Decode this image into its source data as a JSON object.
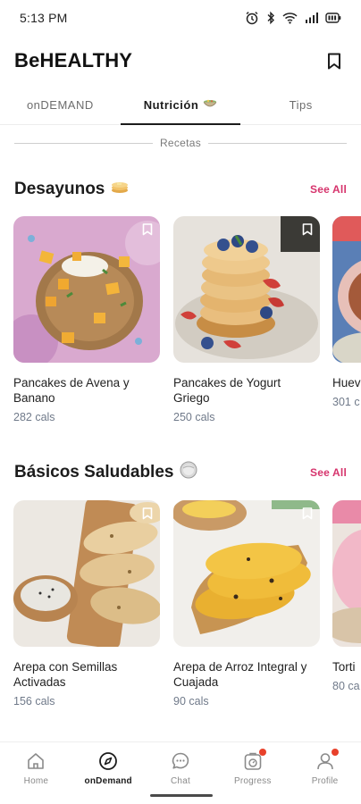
{
  "status_bar": {
    "time": "5:13 PM",
    "icons": [
      "alarm-icon",
      "bluetooth-icon",
      "wifi-icon",
      "signal-icon",
      "battery-icon"
    ]
  },
  "header": {
    "title": "BeHEALTHY",
    "bookmark_icon": "bookmark-icon"
  },
  "tabs": [
    {
      "label": "onDEMAND",
      "active": false
    },
    {
      "label": "Nutrición",
      "active": true,
      "icon": "bowl-icon"
    },
    {
      "label": "Tips",
      "active": false
    }
  ],
  "divider": {
    "label": "Recetas"
  },
  "sections": [
    {
      "title": "Desayunos",
      "icon": "pancake-icon",
      "see_all": "See All",
      "cards": [
        {
          "title": "Pancakes de Avena y Banano",
          "cals": "282 cals"
        },
        {
          "title": "Pancakes de Yogurt Griego",
          "cals": "250 cals"
        },
        {
          "title": "Huev",
          "cals": "301 c"
        }
      ]
    },
    {
      "title": "Básicos Saludables",
      "icon": "plate-icon",
      "see_all": "See All",
      "cards": [
        {
          "title": "Arepa con Semillas Activadas",
          "cals": "156 cals"
        },
        {
          "title": "Arepa de Arroz Integral y Cuajada",
          "cals": "90 cals"
        },
        {
          "title": "Torti",
          "cals": "80 ca"
        }
      ]
    }
  ],
  "bottom_nav": [
    {
      "label": "Home",
      "icon": "home-icon",
      "active": false,
      "badge": false
    },
    {
      "label": "onDemand",
      "icon": "compass-icon",
      "active": true,
      "badge": false
    },
    {
      "label": "Chat",
      "icon": "chat-icon",
      "active": false,
      "badge": false
    },
    {
      "label": "Progress",
      "icon": "progress-icon",
      "active": false,
      "badge": true
    },
    {
      "label": "Profile",
      "icon": "profile-icon",
      "active": false,
      "badge": true
    }
  ],
  "colors": {
    "accent": "#d6336c",
    "badge": "#e8412b",
    "cals_text": "#707a8a"
  }
}
